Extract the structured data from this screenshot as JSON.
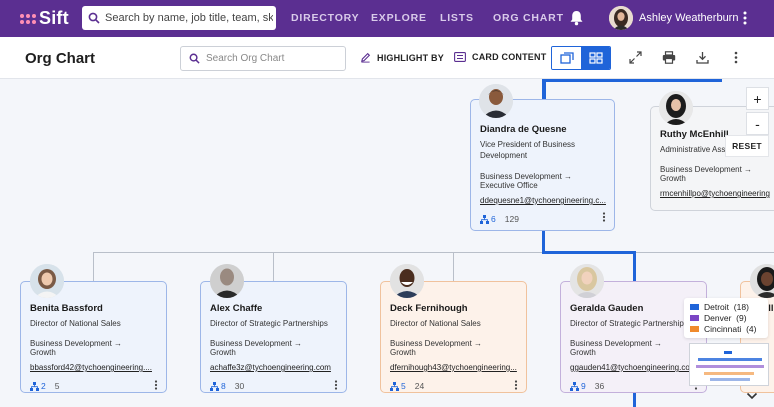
{
  "app": {
    "logo_text": "Sift"
  },
  "nav": {
    "search_placeholder": "Search by name, job title, team, skill or...",
    "items": [
      "DIRECTORY",
      "EXPLORE",
      "LISTS",
      "ORG CHART"
    ],
    "user_name": "Ashley Weatherburn"
  },
  "toolbar": {
    "title": "Org Chart",
    "search_placeholder": "Search Org Chart",
    "highlight_label": "HIGHLIGHT BY",
    "card_content_label": "CARD CONTENT"
  },
  "zoom": {
    "plus": "+",
    "minus": "-",
    "reset_label": "RESET"
  },
  "cards": [
    {
      "name": "Diandra de Quesne",
      "title": "Vice President of Business Development",
      "dept": "Business Development →",
      "dept2": "Executive Office",
      "email": "ddequesne1@tychoengineering.c...",
      "direct": "6",
      "total": "129"
    },
    {
      "name": "Ruthy McEnhill",
      "title": "Administrative Assi",
      "dept": "Business Development →",
      "dept2": "Growth",
      "email": "rmcenhillpo@tychoengineering",
      "direct": "",
      "total": ""
    },
    {
      "name": "Benita Bassford",
      "title": "Director of National Sales",
      "dept": "Business Development →",
      "dept2": "Growth",
      "email": "bbassford42@tychoengineering....",
      "direct": "2",
      "total": "5"
    },
    {
      "name": "Alex Chaffe",
      "title": "Director of Strategic Partnerships",
      "dept": "Business Development →",
      "dept2": "Growth",
      "email": "achaffe3z@tychoengineering.com",
      "direct": "8",
      "total": "30"
    },
    {
      "name": "Deck Fernihough",
      "title": "Director of National Sales",
      "dept": "Business Development →",
      "dept2": "Growth",
      "email": "dfernihough43@tychoengineering...",
      "direct": "5",
      "total": "24"
    },
    {
      "name": "Geralda Gauden",
      "title": "Director of Strategic Partnerships",
      "dept": "Business Development →",
      "dept2": "Growth",
      "email": "ggauden41@tychoengineering.com",
      "direct": "9",
      "total": "36"
    },
    {
      "name": "ell",
      "title": "",
      "dept": "",
      "dept2": "",
      "email": "",
      "direct": "",
      "total": ""
    }
  ],
  "legend": [
    {
      "label": "Detroit",
      "count": "(18)",
      "color": "#1f64d9"
    },
    {
      "label": "Denver",
      "count": "(9)",
      "color": "#7b45c4"
    },
    {
      "label": "Cincinnati",
      "count": "(4)",
      "color": "#f08a2c"
    }
  ],
  "colors": {
    "brand": "#5b2f91",
    "accent": "#1f64d9"
  }
}
